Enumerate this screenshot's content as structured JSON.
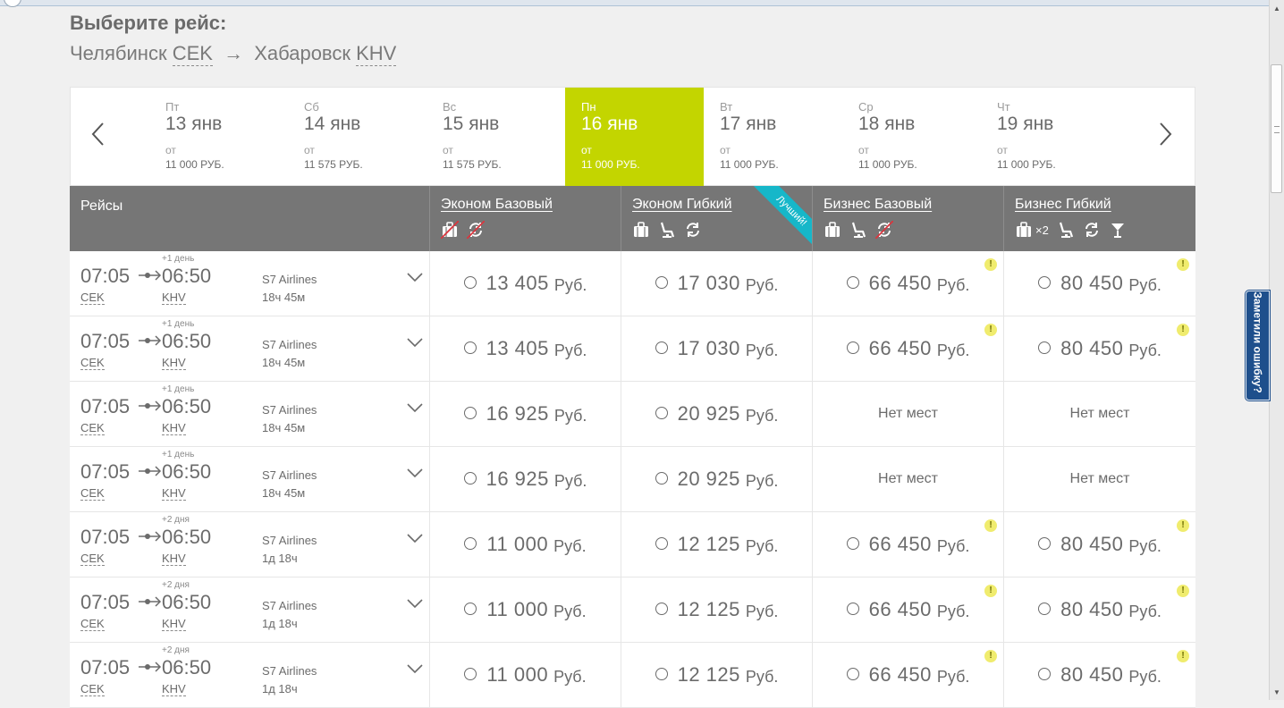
{
  "page": {
    "heading": "Выберите рейс:",
    "route": {
      "from_city": "Челябинск",
      "from_code": "CEK",
      "arrow": "→",
      "to_city": "Хабаровск",
      "to_code": "KHV"
    }
  },
  "dates": [
    {
      "dow": "Пт",
      "date": "13 янв",
      "from": "от",
      "price": "11 000 РУБ.",
      "active": false
    },
    {
      "dow": "Сб",
      "date": "14 янв",
      "from": "от",
      "price": "11 575 РУБ.",
      "active": false
    },
    {
      "dow": "Вс",
      "date": "15 янв",
      "from": "от",
      "price": "11 575 РУБ.",
      "active": false
    },
    {
      "dow": "Пн",
      "date": "16 янв",
      "from": "от",
      "price": "11 000 РУБ.",
      "active": true
    },
    {
      "dow": "Вт",
      "date": "17 янв",
      "from": "от",
      "price": "11 000 РУБ.",
      "active": false
    },
    {
      "dow": "Ср",
      "date": "18 янв",
      "from": "от",
      "price": "11 000 РУБ.",
      "active": false
    },
    {
      "dow": "Чт",
      "date": "19 янв",
      "from": "от",
      "price": "11 000 РУБ.",
      "active": false
    }
  ],
  "table": {
    "flights_header": "Рейсы",
    "fares": [
      {
        "name": "Эконом Базовый",
        "icons": [
          "no-baggage-icon",
          "no-exchange-icon"
        ]
      },
      {
        "name": "Эконом Гибкий",
        "icons": [
          "baggage-icon",
          "seat-icon",
          "exchange-icon"
        ],
        "badge": "Лучший!"
      },
      {
        "name": "Бизнес Базовый",
        "icons": [
          "baggage-icon",
          "seat-icon",
          "no-exchange-icon"
        ]
      },
      {
        "name": "Бизнес Гибкий",
        "icons": [
          "baggage-icon",
          "seat-icon",
          "exchange-icon",
          "cocktail-icon"
        ],
        "baggage_count": "×2"
      }
    ],
    "currency": "Руб.",
    "warn_symbol": "!",
    "rows": [
      {
        "dep": "07:05",
        "arr": "06:50",
        "plus": "+1 день",
        "dep_code": "CEK",
        "arr_code": "KHV",
        "airline": "S7 Airlines",
        "duration": "18ч 45м",
        "prices": [
          {
            "amount": "13 405"
          },
          {
            "amount": "17 030"
          },
          {
            "amount": "66 450",
            "warn": true
          },
          {
            "amount": "80 450",
            "warn": true
          }
        ]
      },
      {
        "dep": "07:05",
        "arr": "06:50",
        "plus": "+1 день",
        "dep_code": "CEK",
        "arr_code": "KHV",
        "airline": "S7 Airlines",
        "duration": "18ч 45м",
        "prices": [
          {
            "amount": "13 405"
          },
          {
            "amount": "17 030"
          },
          {
            "amount": "66 450",
            "warn": true
          },
          {
            "amount": "80 450",
            "warn": true
          }
        ]
      },
      {
        "dep": "07:05",
        "arr": "06:50",
        "plus": "+1 день",
        "dep_code": "CEK",
        "arr_code": "KHV",
        "airline": "S7 Airlines",
        "duration": "18ч 45м",
        "prices": [
          {
            "amount": "16 925"
          },
          {
            "amount": "20 925"
          },
          {
            "text": "Нет мест"
          },
          {
            "text": "Нет мест"
          }
        ]
      },
      {
        "dep": "07:05",
        "arr": "06:50",
        "plus": "+1 день",
        "dep_code": "CEK",
        "arr_code": "KHV",
        "airline": "S7 Airlines",
        "duration": "18ч 45м",
        "prices": [
          {
            "amount": "16 925"
          },
          {
            "amount": "20 925"
          },
          {
            "text": "Нет мест"
          },
          {
            "text": "Нет мест"
          }
        ]
      },
      {
        "dep": "07:05",
        "arr": "06:50",
        "plus": "+2 дня",
        "dep_code": "CEK",
        "arr_code": "KHV",
        "airline": "S7 Airlines",
        "duration": "1д 18ч",
        "prices": [
          {
            "amount": "11 000"
          },
          {
            "amount": "12 125"
          },
          {
            "amount": "66 450",
            "warn": true
          },
          {
            "amount": "80 450",
            "warn": true
          }
        ]
      },
      {
        "dep": "07:05",
        "arr": "06:50",
        "plus": "+2 дня",
        "dep_code": "CEK",
        "arr_code": "KHV",
        "airline": "S7 Airlines",
        "duration": "1д 18ч",
        "prices": [
          {
            "amount": "11 000"
          },
          {
            "amount": "12 125"
          },
          {
            "amount": "66 450",
            "warn": true
          },
          {
            "amount": "80 450",
            "warn": true
          }
        ]
      },
      {
        "dep": "07:05",
        "arr": "06:50",
        "plus": "+2 дня",
        "dep_code": "CEK",
        "arr_code": "KHV",
        "airline": "S7 Airlines",
        "duration": "1д 18ч",
        "prices": [
          {
            "amount": "11 000"
          },
          {
            "amount": "12 125"
          },
          {
            "amount": "66 450",
            "warn": true
          },
          {
            "amount": "80 450",
            "warn": true
          }
        ]
      }
    ]
  },
  "feedback_tab": "Заметили ошибку?",
  "colors": {
    "active_date": "#c3d500",
    "header_bg": "#767676",
    "badge": "#16b7c9",
    "feedback_tab": "#1e4f8c",
    "warn": "#f0ec6e"
  }
}
